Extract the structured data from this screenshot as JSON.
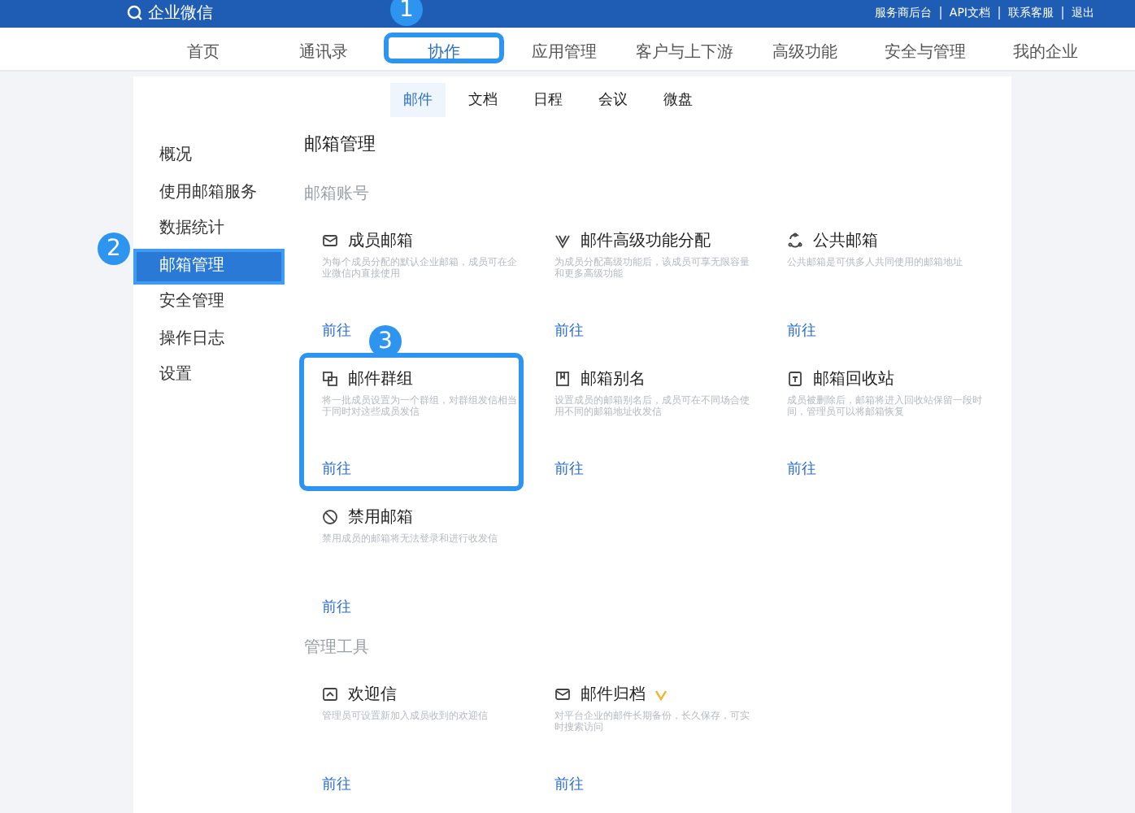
{
  "topbar": {
    "logo": "企业微信",
    "links": [
      "服务商后台",
      "API文档",
      "联系客服",
      "退出"
    ]
  },
  "nav": [
    {
      "label": "首页",
      "selected": false
    },
    {
      "label": "通讯录",
      "selected": false
    },
    {
      "label": "协作",
      "selected": true,
      "callout": "1"
    },
    {
      "label": "应用管理",
      "selected": false
    },
    {
      "label": "客户与上下游",
      "selected": false
    },
    {
      "label": "高级功能",
      "selected": false
    },
    {
      "label": "安全与管理",
      "selected": false
    },
    {
      "label": "我的企业",
      "selected": false
    }
  ],
  "subtabs": [
    {
      "label": "邮件",
      "selected": true
    },
    {
      "label": "文档",
      "selected": false
    },
    {
      "label": "日程",
      "selected": false
    },
    {
      "label": "会议",
      "selected": false
    },
    {
      "label": "微盘",
      "selected": false
    }
  ],
  "sidebar": [
    {
      "label": "概况",
      "selected": false
    },
    {
      "label": "使用邮箱服务",
      "selected": false
    },
    {
      "label": "数据统计",
      "selected": false
    },
    {
      "label": "邮箱管理",
      "selected": true,
      "callout": "2"
    },
    {
      "label": "安全管理",
      "selected": false
    },
    {
      "label": "操作日志",
      "selected": false
    },
    {
      "label": "设置",
      "selected": false
    }
  ],
  "title": "邮箱管理",
  "sections": [
    {
      "heading": "邮箱账号",
      "cards": [
        {
          "kind": "mail",
          "title": "成员邮箱",
          "description": "为每个成员分配的默认企业邮箱，成员可在企业微信内直接使用",
          "link": "前往"
        },
        {
          "kind": "feature",
          "title": "邮件高级功能分配",
          "description": "为成员分配高级功能后，该成员可享无限容量和更多高级功能",
          "link": "前往"
        },
        {
          "kind": "public",
          "title": "公共邮箱",
          "description": "公共邮箱是可供多人共同使用的邮箱地址",
          "link": "前往"
        },
        {
          "kind": "group",
          "title": "邮件群组",
          "description": "将一批成员设置为一个群组，对群组发信相当于同时对这些成员发信",
          "link": "前往",
          "callout": "3"
        },
        {
          "kind": "alias",
          "title": "邮箱别名",
          "description": "设置成员的邮箱别名后，成员可在不同场合使用不同的邮箱地址收发信",
          "link": "前往"
        },
        {
          "kind": "recycle",
          "title": "邮箱回收站",
          "description": "成员被删除后，邮箱将进入回收站保留一段时间，管理员可以将邮箱恢复",
          "link": "前往"
        },
        {
          "kind": "ban",
          "title": "禁用邮箱",
          "description": "禁用成员的邮箱将无法登录和进行收发信",
          "link": "前往"
        }
      ]
    },
    {
      "heading": "管理工具",
      "cards": [
        {
          "kind": "welcome",
          "title": "欢迎信",
          "description": "管理员可设置新加入成员收到的欢迎信",
          "link": "前往"
        },
        {
          "kind": "mail",
          "title": "邮件归档",
          "description": "对平台企业的邮件长期备份，长久保存，可实时搜索访问",
          "link": "前往",
          "vip": true
        }
      ]
    }
  ]
}
